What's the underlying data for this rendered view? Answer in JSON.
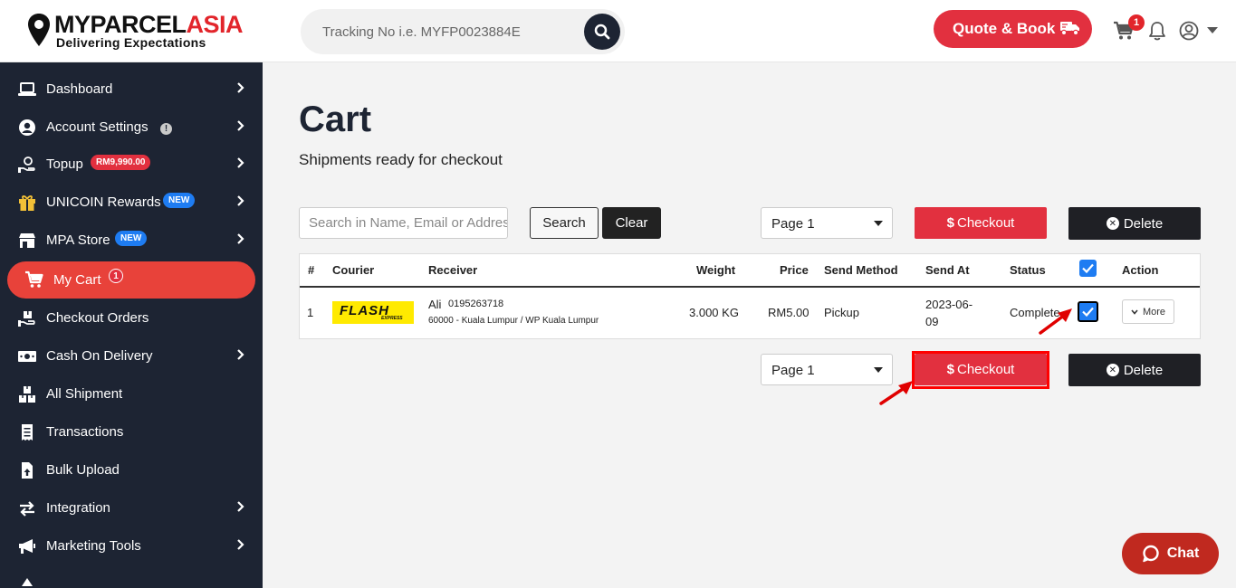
{
  "header": {
    "logo_part1": "MYPARCEL",
    "logo_part2": "ASIA",
    "logo_tagline": "Delivering Expectations",
    "tracking_placeholder": "Tracking No i.e. MYFP0023884E",
    "quote_label": "Quote & Book",
    "cart_count": "1"
  },
  "sidebar": {
    "items": [
      {
        "label": "Dashboard",
        "icon": "laptop-icon"
      },
      {
        "label": "Account Settings",
        "icon": "user-circle-icon",
        "info": "!"
      },
      {
        "label": "Topup",
        "icon": "hand-money-icon",
        "badge": "RM9,990.00"
      },
      {
        "label": "UNICOIN Rewards",
        "icon": "gift-icon",
        "badge": "NEW"
      },
      {
        "label": "MPA Store",
        "icon": "store-icon",
        "badge": "NEW"
      },
      {
        "label": "My Cart",
        "icon": "cart-icon",
        "badge": "1"
      },
      {
        "label": "Checkout Orders",
        "icon": "hand-box-icon"
      },
      {
        "label": "Cash On Delivery",
        "icon": "money-bill-icon"
      },
      {
        "label": "All Shipment",
        "icon": "boxes-icon"
      },
      {
        "label": "Transactions",
        "icon": "receipt-icon"
      },
      {
        "label": "Bulk Upload",
        "icon": "file-upload-icon"
      },
      {
        "label": "Integration",
        "icon": "exchange-icon"
      },
      {
        "label": "Marketing Tools",
        "icon": "megaphone-icon"
      }
    ]
  },
  "main": {
    "title": "Cart",
    "subtitle": "Shipments ready for checkout",
    "search_placeholder": "Search in Name, Email or Address",
    "search_label": "Search",
    "clear_label": "Clear",
    "page_value": "Page 1",
    "checkout_label": "Checkout",
    "delete_label": "Delete"
  },
  "table": {
    "headers": {
      "num": "#",
      "courier": "Courier",
      "receiver": "Receiver",
      "weight": "Weight",
      "price": "Price",
      "send_method": "Send Method",
      "send_at": "Send At",
      "status": "Status",
      "action": "Action"
    },
    "rows": [
      {
        "num": "1",
        "courier_logo": "FLASH",
        "courier_sub": "EXPRESS",
        "receiver_name": "Ali",
        "receiver_phone": "0195263718",
        "receiver_address": "60000 - Kuala Lumpur / WP Kuala Lumpur",
        "weight": "3.000 KG",
        "price": "RM5.00",
        "send_method": "Pickup",
        "send_at_line1": "2023-06-",
        "send_at_line2": "09",
        "status": "Complete",
        "action": "More"
      }
    ]
  },
  "chat": {
    "label": "Chat"
  },
  "colors": {
    "accent": "#e2303f",
    "sidebar": "#1d2433",
    "active": "#e8423a",
    "check": "#1e7cf2"
  }
}
